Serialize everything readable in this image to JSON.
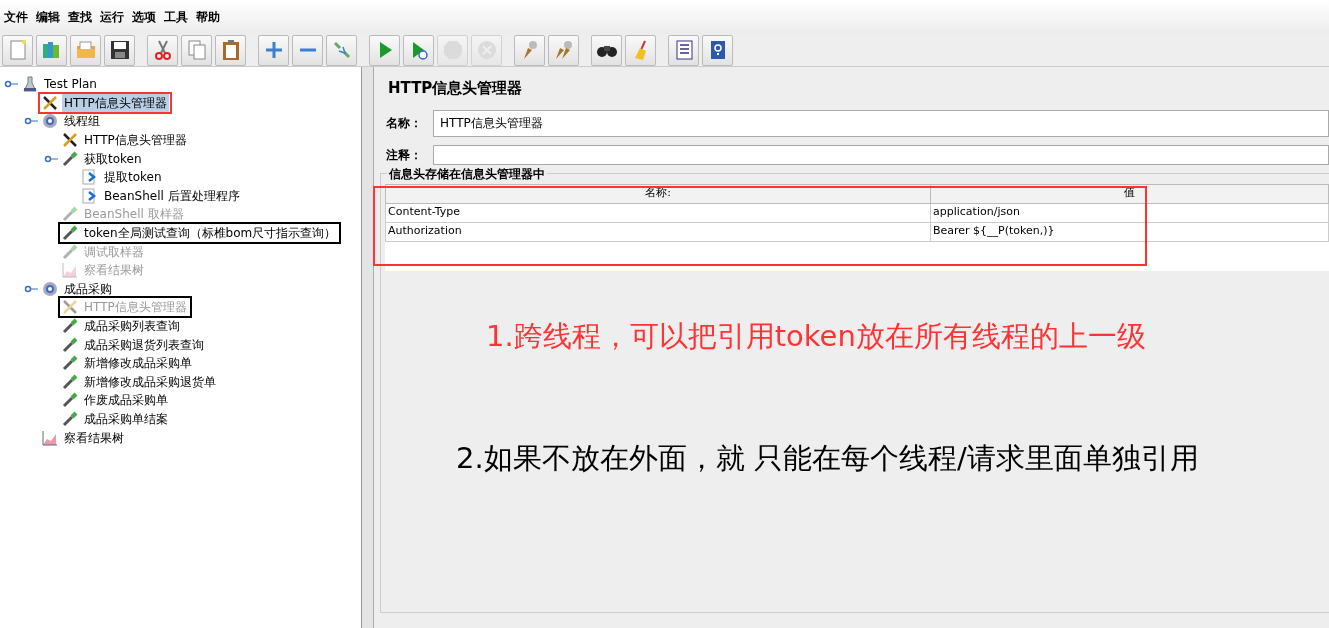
{
  "menu": [
    "文件",
    "编辑",
    "查找",
    "运行",
    "选项",
    "工具",
    "帮助"
  ],
  "toolbar": [
    [
      {
        "kind": "new",
        "disabled": false
      },
      {
        "kind": "templates",
        "disabled": false
      },
      {
        "kind": "open",
        "disabled": false
      },
      {
        "kind": "save",
        "disabled": false
      }
    ],
    [
      {
        "kind": "cut",
        "disabled": false
      },
      {
        "kind": "copy",
        "disabled": false
      },
      {
        "kind": "paste",
        "disabled": false
      }
    ],
    [
      {
        "kind": "expand",
        "disabled": false
      },
      {
        "kind": "collapse",
        "disabled": false
      },
      {
        "kind": "toggle",
        "disabled": false
      }
    ],
    [
      {
        "kind": "start",
        "disabled": false
      },
      {
        "kind": "start-no-pause",
        "disabled": false
      },
      {
        "kind": "stop",
        "disabled": true
      },
      {
        "kind": "shutdown",
        "disabled": true
      }
    ],
    [
      {
        "kind": "clear",
        "disabled": false
      },
      {
        "kind": "clear-all",
        "disabled": false
      }
    ],
    [
      {
        "kind": "search",
        "disabled": false
      },
      {
        "kind": "reset-search",
        "disabled": false
      }
    ],
    [
      {
        "kind": "function-helper",
        "disabled": false
      },
      {
        "kind": "help",
        "disabled": false
      }
    ]
  ],
  "tree": [
    {
      "label": "Test Plan",
      "kind": "plan",
      "expanded": true,
      "disabled": false,
      "selected": false,
      "children": [
        {
          "label": "HTTP信息头管理器",
          "kind": "header",
          "disabled": false,
          "selected": true,
          "color": "#ff3333"
        },
        {
          "label": "线程组",
          "kind": "threadgroup",
          "expanded": true,
          "disabled": false,
          "selected": false,
          "children": [
            {
              "label": "HTTP信息头管理器",
              "kind": "header",
              "disabled": false,
              "selected": false
            },
            {
              "label": "获取token",
              "kind": "sampler",
              "expanded": true,
              "disabled": false,
              "selected": false,
              "children": [
                {
                  "label": "提取token",
                  "kind": "postprocessor",
                  "disabled": false,
                  "selected": false
                },
                {
                  "label": "BeanShell 后置处理程序",
                  "kind": "postprocessor",
                  "disabled": false,
                  "selected": false
                }
              ]
            },
            {
              "label": "BeanShell 取样器",
              "kind": "sampler",
              "disabled": true,
              "selected": false
            },
            {
              "label": "token全局测试查询（标椎bom尺寸指示查询）",
              "kind": "sampler",
              "disabled": false,
              "selected": false,
              "color": "#000000"
            },
            {
              "label": "调试取样器",
              "kind": "sampler",
              "disabled": true,
              "selected": false
            },
            {
              "label": "察看结果树",
              "kind": "listener",
              "disabled": true,
              "selected": false
            }
          ]
        },
        {
          "label": "成品采购",
          "kind": "threadgroup",
          "expanded": true,
          "disabled": false,
          "selected": false,
          "children": [
            {
              "label": "HTTP信息头管理器",
              "kind": "header",
              "disabled": true,
              "selected": false,
              "color": "#000000"
            },
            {
              "label": "成品采购列表查询",
              "kind": "sampler",
              "disabled": false,
              "selected": false
            },
            {
              "label": "成品采购退货列表查询",
              "kind": "sampler",
              "disabled": false,
              "selected": false
            },
            {
              "label": "新增修改成品采购单",
              "kind": "sampler",
              "disabled": false,
              "selected": false
            },
            {
              "label": "新增修改成品采购退货单",
              "kind": "sampler",
              "disabled": false,
              "selected": false
            },
            {
              "label": "作废成品采购单",
              "kind": "sampler",
              "disabled": false,
              "selected": false
            },
            {
              "label": "成品采购单结案",
              "kind": "sampler",
              "disabled": false,
              "selected": false
            }
          ]
        },
        {
          "label": "察看结果树",
          "kind": "listener",
          "disabled": false,
          "selected": false
        }
      ]
    }
  ],
  "panel": {
    "title": "HTTP信息头管理器",
    "name_label": "名称：",
    "name_value": "HTTP信息头管理器",
    "comment_label": "注释：",
    "group_title": "信息头存储在信息头管理器中",
    "table": {
      "columns": [
        "名称:",
        "值"
      ],
      "highlighted": true,
      "rows": [
        [
          "Content-Type",
          "application/json"
        ],
        [
          "Authorization",
          "Bearer ${__P(token,)}"
        ]
      ]
    }
  },
  "annotations": [
    {
      "text": "1.跨线程，可以把引用token放在所有线程的上一级",
      "color": "#ff3333"
    },
    {
      "text": "2.如果不放在外面，就 只能在每个线程/请求里面单独引用",
      "color": "#000000"
    }
  ]
}
